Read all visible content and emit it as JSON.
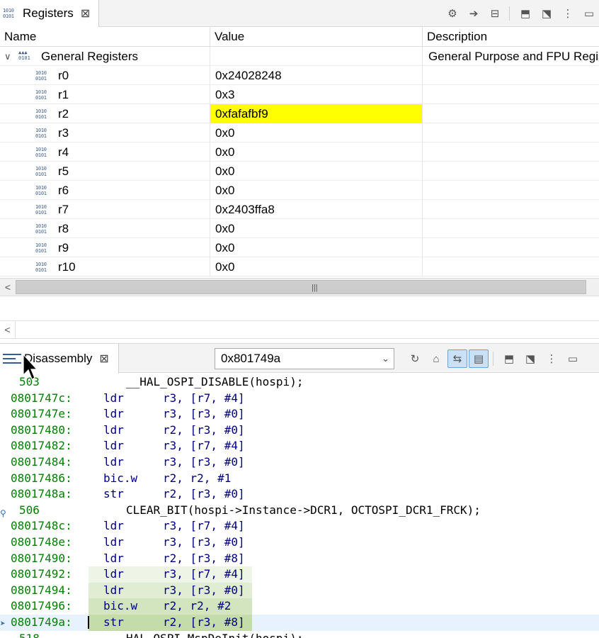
{
  "registers_view": {
    "tab_label": "Registers",
    "columns": {
      "name": "Name",
      "value": "Value",
      "description": "Description"
    },
    "group": {
      "name": "General Registers",
      "description": "General Purpose and FPU Regis"
    },
    "rows": [
      {
        "name": "r0",
        "value": "0x24028248",
        "highlighted": false
      },
      {
        "name": "r1",
        "value": "0x3",
        "highlighted": false
      },
      {
        "name": "r2",
        "value": "0xfafafbf9",
        "highlighted": true
      },
      {
        "name": "r3",
        "value": "0x0",
        "highlighted": false
      },
      {
        "name": "r4",
        "value": "0x0",
        "highlighted": false
      },
      {
        "name": "r5",
        "value": "0x0",
        "highlighted": false
      },
      {
        "name": "r6",
        "value": "0x0",
        "highlighted": false
      },
      {
        "name": "r7",
        "value": "0x2403ffa8",
        "highlighted": false
      },
      {
        "name": "r8",
        "value": "0x0",
        "highlighted": false
      },
      {
        "name": "r9",
        "value": "0x0",
        "highlighted": false
      },
      {
        "name": "r10",
        "value": "0x0",
        "highlighted": false
      }
    ],
    "highlight_color": "#ffff00"
  },
  "disassembly_view": {
    "tab_label": "Disassembly",
    "address_input": "0x801749a",
    "colors": {
      "address": "#008000",
      "instruction": "#000080",
      "current_line": "#e8f2fe"
    },
    "lines": [
      {
        "kind": "src",
        "lineno": "503",
        "text": "__HAL_OSPI_DISABLE(hospi);"
      },
      {
        "kind": "asm",
        "addr": "0801747c:",
        "mnem": "ldr",
        "ops": "r3, [r7, #4]"
      },
      {
        "kind": "asm",
        "addr": "0801747e:",
        "mnem": "ldr",
        "ops": "r3, [r3, #0]"
      },
      {
        "kind": "asm",
        "addr": "08017480:",
        "mnem": "ldr",
        "ops": "r2, [r3, #0]"
      },
      {
        "kind": "asm",
        "addr": "08017482:",
        "mnem": "ldr",
        "ops": "r3, [r7, #4]"
      },
      {
        "kind": "asm",
        "addr": "08017484:",
        "mnem": "ldr",
        "ops": "r3, [r3, #0]"
      },
      {
        "kind": "asm",
        "addr": "08017486:",
        "mnem": "bic.w",
        "ops": "r2, r2, #1"
      },
      {
        "kind": "asm",
        "addr": "0801748a:",
        "mnem": "str",
        "ops": "r2, [r3, #0]"
      },
      {
        "kind": "src",
        "lineno": "506",
        "text": "CLEAR_BIT(hospi->Instance->DCR1, OCTOSPI_DCR1_FRCK);",
        "breakpoint": true
      },
      {
        "kind": "asm",
        "addr": "0801748c:",
        "mnem": "ldr",
        "ops": "r3, [r7, #4]"
      },
      {
        "kind": "asm",
        "addr": "0801748e:",
        "mnem": "ldr",
        "ops": "r3, [r3, #0]"
      },
      {
        "kind": "asm",
        "addr": "08017490:",
        "mnem": "ldr",
        "ops": "r2, [r3, #8]"
      },
      {
        "kind": "asm",
        "addr": "08017492:",
        "mnem": "ldr",
        "ops": "r3, [r7, #4]",
        "tint": "#eef5e6"
      },
      {
        "kind": "asm",
        "addr": "08017494:",
        "mnem": "ldr",
        "ops": "r3, [r3, #0]",
        "tint": "#e0edd2"
      },
      {
        "kind": "asm",
        "addr": "08017496:",
        "mnem": "bic.w",
        "ops": "r2, r2, #2",
        "tint": "#d2e5bf"
      },
      {
        "kind": "asm",
        "addr": "0801749a:",
        "mnem": "str",
        "ops": "r2, [r3, #8]",
        "tint": "#c3dca9",
        "current": true
      },
      {
        "kind": "src",
        "lineno": "518",
        "text": "HAL_OSPI_MspDeInit(hospi);"
      }
    ]
  }
}
